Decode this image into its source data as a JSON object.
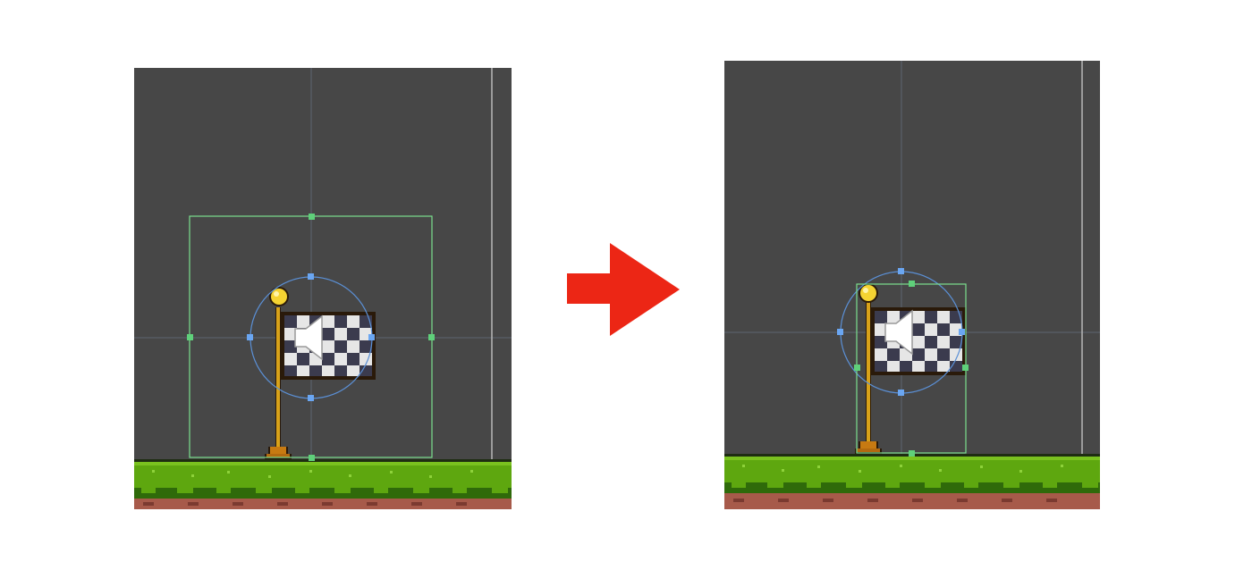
{
  "colors": {
    "background": "#ffffff",
    "panel_background": "#474747",
    "guide_line": "#5c6472",
    "viewport_edge": "#b7b7b7",
    "collider_box": "#7be08e",
    "audio_radius": "#5b90d6",
    "arrow": "#ec2615",
    "grass": "#5ea70f",
    "grass_dark": "#2f6a0a",
    "dirt": "#a75a4a",
    "flag_light": "#e6e6e6",
    "flag_dark": "#2d2d3a",
    "pole_gold": "#d8a21a"
  },
  "panels": [
    {
      "id": "before",
      "description_icons": [
        "checkered-flag-icon",
        "speaker-icon",
        "grass-ground-tiles"
      ],
      "collider_state": "large-box"
    },
    {
      "id": "after",
      "description_icons": [
        "checkered-flag-icon",
        "speaker-icon",
        "grass-ground-tiles"
      ],
      "collider_state": "tight-box"
    }
  ],
  "transition_icon": "right-arrow-icon"
}
